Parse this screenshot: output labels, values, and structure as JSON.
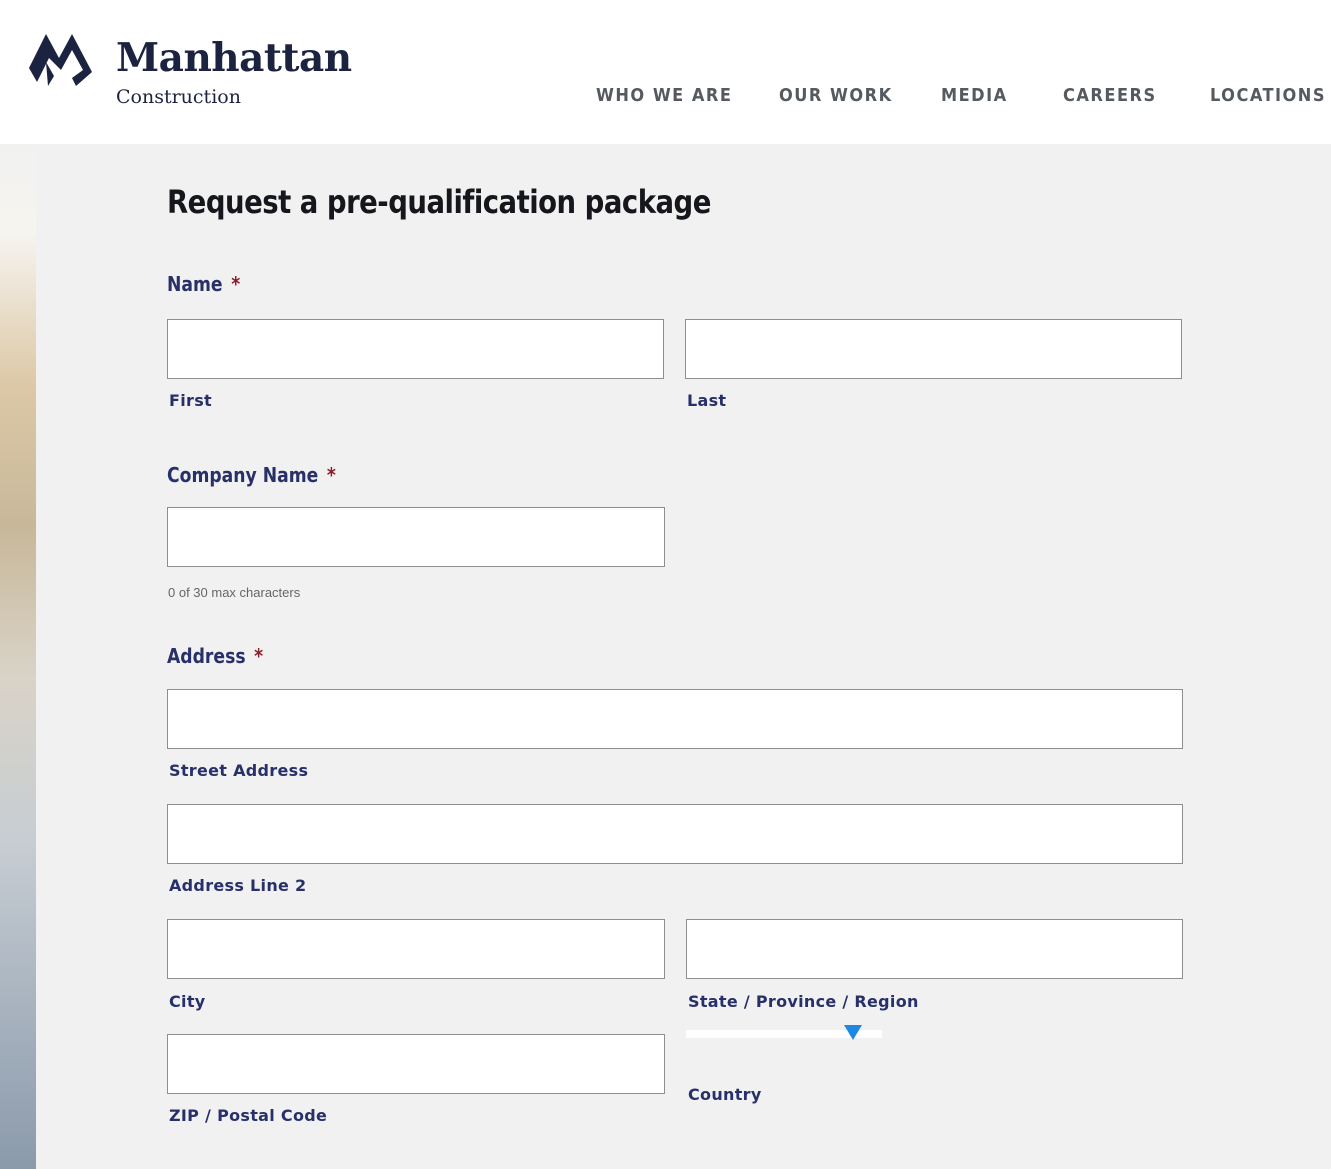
{
  "brand": {
    "name": "Manhattan",
    "subtitle": "Construction",
    "color": "#1c2340"
  },
  "nav": {
    "items": [
      {
        "label": "WHO WE ARE"
      },
      {
        "label": "OUR WORK"
      },
      {
        "label": "MEDIA"
      },
      {
        "label": "CAREERS"
      },
      {
        "label": "LOCATIONS"
      }
    ]
  },
  "form": {
    "title": "Request a pre-qualification package",
    "name": {
      "label": "Name",
      "required_mark": "*",
      "first": {
        "value": "",
        "sublabel": "First"
      },
      "last": {
        "value": "",
        "sublabel": "Last"
      }
    },
    "company": {
      "label": "Company Name",
      "required_mark": "*",
      "value": "",
      "counter": "0 of 30 max characters"
    },
    "address": {
      "label": "Address",
      "required_mark": "*",
      "street": {
        "value": "",
        "sublabel": "Street Address"
      },
      "line2": {
        "value": "",
        "sublabel": "Address Line 2"
      },
      "city": {
        "value": "",
        "sublabel": "City"
      },
      "state": {
        "value": "",
        "sublabel": "State / Province / Region"
      },
      "zip": {
        "value": "",
        "sublabel": "ZIP / Postal Code"
      },
      "country": {
        "value": "",
        "sublabel": "Country"
      }
    }
  },
  "colors": {
    "label": "#28306a",
    "required": "#8b1c2a",
    "select_arrow": "#1e88e5",
    "background": "#f1f1f1"
  }
}
